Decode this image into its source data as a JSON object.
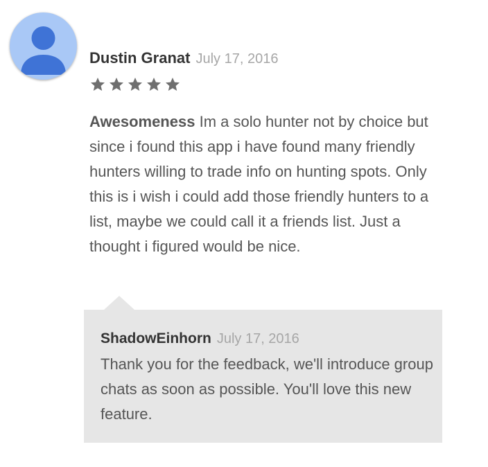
{
  "review": {
    "avatar_icon": "person-avatar-icon",
    "author": "Dustin Granat",
    "date": "July 17, 2016",
    "rating": 5,
    "rating_max": 5,
    "star_color": "#6f6f6f",
    "title": "Awesomeness",
    "body": "Im a solo hunter not by choice but since i found this app i have found many friendly hunters willing to trade info on hunting spots. Only this is i wish i could add those friendly hunters to a list, maybe we could call it a friends list. Just a thought i figured would be nice."
  },
  "reply": {
    "author": "ShadowEinhorn",
    "date": "July 17, 2016",
    "body": "Thank you for the feedback, we'll introduce group chats as soon as possible. You'll love this new feature.",
    "background_color": "#e6e6e6"
  },
  "colors": {
    "avatar_background": "#a9c8f6",
    "avatar_figure": "#3f73d6",
    "text_primary": "#333333",
    "text_secondary": "#a6a6a6"
  }
}
